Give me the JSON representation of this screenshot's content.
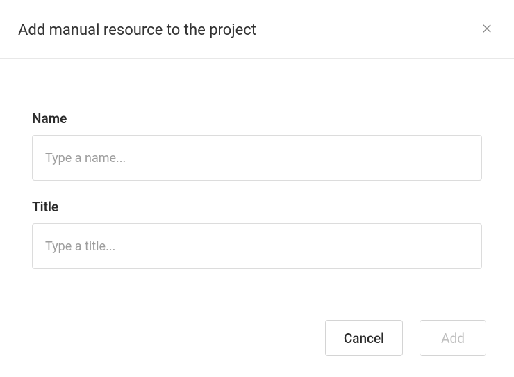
{
  "dialog": {
    "title": "Add manual resource to the project",
    "fields": {
      "name": {
        "label": "Name",
        "placeholder": "Type a name...",
        "value": ""
      },
      "title": {
        "label": "Title",
        "placeholder": "Type a title...",
        "value": ""
      }
    },
    "actions": {
      "cancel": "Cancel",
      "add": "Add"
    }
  }
}
